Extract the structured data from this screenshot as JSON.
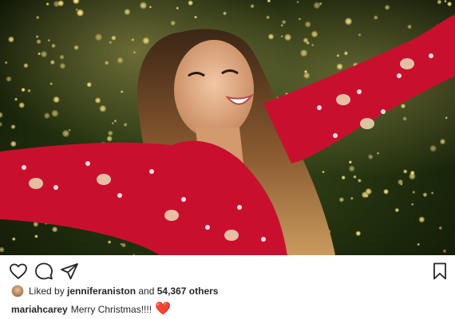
{
  "post": {
    "photo_alt_subject": "",
    "actions": {
      "like_icon": "heart-outline-icon",
      "comment_icon": "comment-icon",
      "share_icon": "send-icon",
      "save_icon": "bookmark-icon"
    },
    "likes": {
      "prefix": "Liked by ",
      "user": "jenniferaniston",
      "middle": " and ",
      "count": "54,367 others"
    },
    "caption": {
      "username": "mariahcarey",
      "text": "Merry Christmas!!!!",
      "emoji": "❤️"
    }
  },
  "colors": {
    "heart": "#e01e3c",
    "pajama_red": "#c8102e",
    "text": "#262626"
  }
}
